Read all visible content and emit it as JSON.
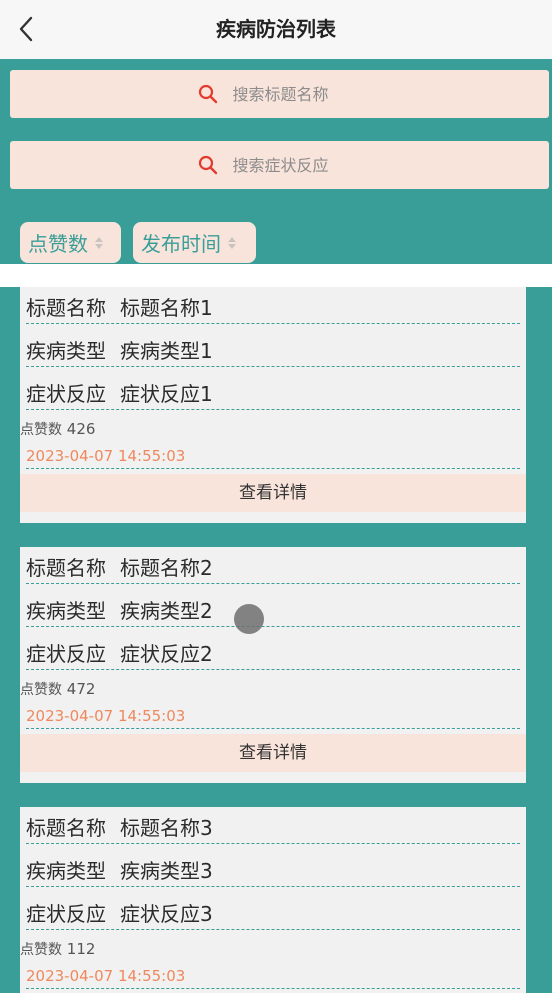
{
  "header": {
    "title": "疾病防治列表"
  },
  "search": {
    "title_placeholder": "搜索标题名称",
    "symptom_placeholder": "搜索症状反应"
  },
  "sort": {
    "likes_label": "点赞数",
    "time_label": "发布时间"
  },
  "labels": {
    "title": "标题名称",
    "disease_type": "疾病类型",
    "symptom": "症状反应",
    "likes": "点赞数",
    "detail_button": "查看详情"
  },
  "items": [
    {
      "title": "标题名称1",
      "disease_type": "疾病类型1",
      "symptom": "症状反应1",
      "likes": "426",
      "time": "2023-04-07 14:55:03"
    },
    {
      "title": "标题名称2",
      "disease_type": "疾病类型2",
      "symptom": "症状反应2",
      "likes": "472",
      "time": "2023-04-07 14:55:03"
    },
    {
      "title": "标题名称3",
      "disease_type": "疾病类型3",
      "symptom": "症状反应3",
      "likes": "112",
      "time": "2023-04-07 14:55:03"
    }
  ],
  "colors": {
    "primary": "#3a9e98",
    "accent_bg": "#f9e4dc",
    "time_text": "#f0885e",
    "search_icon": "#e23b2e"
  },
  "icons": {
    "back": "chevron-left-icon",
    "search": "search-icon",
    "sort": "sort-arrows-icon"
  }
}
